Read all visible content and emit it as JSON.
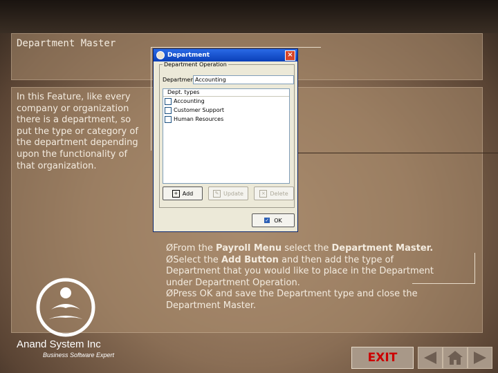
{
  "slide": {
    "title": "Department Master",
    "description": "In this Feature, like every company or organization there is a department, so put the type or category of the department depending upon the functionality of that organization."
  },
  "dialog": {
    "window_title": "Department",
    "group_label": "Department Operation",
    "dept_label": "Department",
    "dept_value": "Accounting",
    "list_header": "Dept. types",
    "list_items": [
      "Accounting",
      "Customer Support",
      "Human Resources"
    ],
    "buttons": {
      "add": "Add",
      "update": "Update",
      "delete": "Delete",
      "ok": "OK"
    }
  },
  "instructions": {
    "line1_pre": "From the ",
    "line1_b1": "Payroll Menu",
    "line1_mid": " select the ",
    "line1_b2": "Department Master.",
    "line2_pre": "Select the ",
    "line2_b": "Add Button",
    "line2_post": " and then add the type of Department that you would like to place in the Department under Department Operation.",
    "line3": "Press OK and save the Department type and close the Department Master.",
    "bullet": "Ø"
  },
  "branding": {
    "company_name": "Anand System Inc",
    "tagline": "Business Software Expert"
  },
  "nav": {
    "exit_label": "EXIT"
  },
  "colors": {
    "exit_text": "#cc0000",
    "titlebar": "#0a3fb8"
  }
}
